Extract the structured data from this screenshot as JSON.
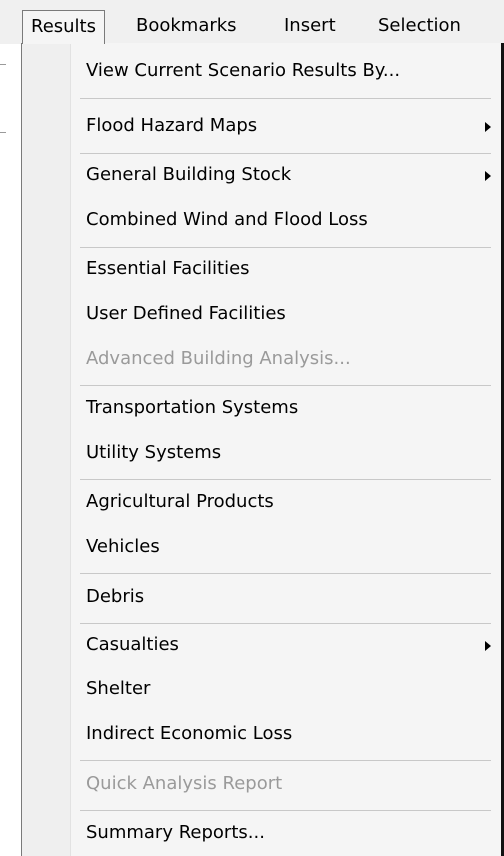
{
  "menubar": {
    "items": [
      "Results",
      "Bookmarks",
      "Insert",
      "Selection"
    ]
  },
  "menu": {
    "items": [
      {
        "label": "View Current Scenario Results By...",
        "enabled": true
      },
      {
        "label": "Flood Hazard Maps",
        "enabled": true,
        "submenu": true
      },
      {
        "label": "General Building Stock",
        "enabled": true,
        "submenu": true
      },
      {
        "label": "Combined Wind and Flood Loss",
        "enabled": true
      },
      {
        "label": "Essential Facilities",
        "enabled": true
      },
      {
        "label": "User Defined Facilities",
        "enabled": true
      },
      {
        "label": "Advanced Building Analysis...",
        "enabled": false
      },
      {
        "label": "Transportation Systems",
        "enabled": true
      },
      {
        "label": "Utility Systems",
        "enabled": true
      },
      {
        "label": "Agricultural Products",
        "enabled": true
      },
      {
        "label": "Vehicles",
        "enabled": true
      },
      {
        "label": "Debris",
        "enabled": true
      },
      {
        "label": "Casualties",
        "enabled": true,
        "submenu": true
      },
      {
        "label": "Shelter",
        "enabled": true
      },
      {
        "label": "Indirect Economic Loss",
        "enabled": true
      },
      {
        "label": "Quick Analysis Report",
        "enabled": false
      },
      {
        "label": "Summary Reports...",
        "enabled": true
      }
    ]
  },
  "colors": {
    "menu_background": "#f5f5f5",
    "disabled_text": "#9a9a9a",
    "separator": "#c8c8c8"
  },
  "icons": {
    "submenu": "submenu-arrow-icon"
  }
}
